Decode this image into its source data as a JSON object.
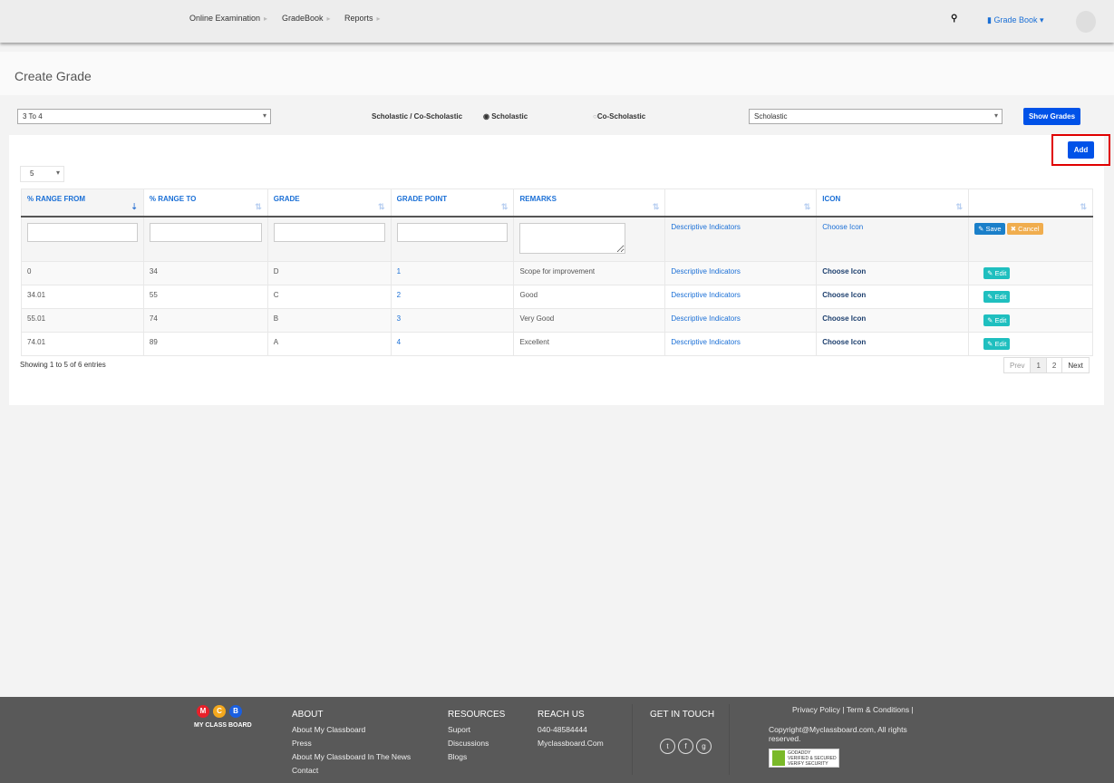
{
  "nav": {
    "items": [
      "Online Examination",
      "GradeBook",
      "Reports"
    ],
    "gradebook_menu": "Grade Book",
    "icons": [
      "search-icon",
      "book-icon",
      "avatar"
    ]
  },
  "page": {
    "title": "Create Grade"
  },
  "filters": {
    "class_select": "3 To 4",
    "type_label": "Scholastic / Co-Scholastic",
    "radio_options": [
      {
        "label": "Scholastic",
        "checked": true
      },
      {
        "label": "Co-Scholastic",
        "checked": false
      }
    ],
    "category_select": "Scholastic",
    "show_button": "Show Grades"
  },
  "add_button": "Add",
  "page_length": "5",
  "table": {
    "headers": [
      "% RANGE FROM",
      "% RANGE TO",
      "GRADE",
      "GRADE POINT",
      "REMARKS",
      "",
      "ICON",
      ""
    ],
    "new_row": {
      "descriptive": "Descriptive Indicators",
      "icon": "Choose Icon",
      "save": "Save",
      "cancel": "Cancel"
    },
    "rows": [
      {
        "from": "0",
        "to": "34",
        "grade": "D",
        "point": "1",
        "remarks": "Scope for improvement",
        "descriptive": "Descriptive Indicators",
        "icon": "Choose Icon",
        "edit": "Edit"
      },
      {
        "from": "34.01",
        "to": "55",
        "grade": "C",
        "point": "2",
        "remarks": "Good",
        "descriptive": "Descriptive Indicators",
        "icon": "Choose Icon",
        "edit": "Edit"
      },
      {
        "from": "55.01",
        "to": "74",
        "grade": "B",
        "point": "3",
        "remarks": "Very Good",
        "descriptive": "Descriptive Indicators",
        "icon": "Choose Icon",
        "edit": "Edit"
      },
      {
        "from": "74.01",
        "to": "89",
        "grade": "A",
        "point": "4",
        "remarks": "Excellent",
        "descriptive": "Descriptive Indicators",
        "icon": "Choose Icon",
        "edit": "Edit"
      }
    ]
  },
  "info": "Showing 1 to 5 of 6 entries",
  "pagination": {
    "prev": "Prev",
    "pages": [
      "1",
      "2"
    ],
    "next": "Next"
  },
  "footer": {
    "logo_letters": [
      "M",
      "C",
      "B"
    ],
    "logo_text": "MY CLASS BOARD",
    "about": {
      "title": "ABOUT",
      "links": [
        "About My Classboard",
        "Press",
        "About My Classboard In The News",
        "Contact"
      ]
    },
    "resources": {
      "title": "RESOURCES",
      "links": [
        "Suport",
        "Discussions",
        "Blogs"
      ]
    },
    "reach": {
      "title": "REACH US",
      "lines": [
        "040-48584444",
        "Myclassboard.Com"
      ]
    },
    "touch": {
      "title": "GET IN TOUCH",
      "social": [
        "twitter-icon",
        "facebook-icon",
        "google-plus-icon"
      ]
    },
    "legal": [
      "Privacy Policy",
      "Term & Conditions"
    ],
    "copyright": "Copyright@Myclassboard.com, All rights reserved.",
    "badge": [
      "GODADDY",
      "VERIFIED & SECURED",
      "VERIFY SECURITY"
    ]
  },
  "colors": {
    "primary": "#0052e8",
    "save": "#1a7fc9",
    "cancel": "#f0ad4e",
    "edit": "#1fbfbf",
    "footer": "#595959",
    "highlight": "#e00000"
  }
}
